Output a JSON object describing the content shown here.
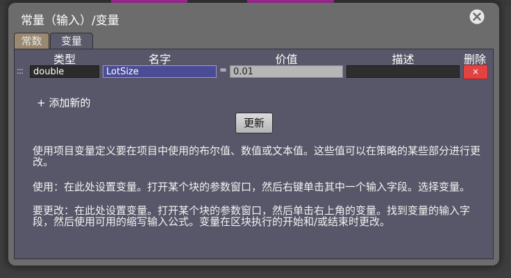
{
  "dialog": {
    "title": "常量（输入）/变量"
  },
  "tabs": [
    {
      "label": "常数"
    },
    {
      "label": "变量"
    }
  ],
  "table": {
    "headers": {
      "type": "类型",
      "name": "名字",
      "value": "价值",
      "description": "描述",
      "delete": "删除"
    },
    "rows": [
      {
        "type": "double",
        "name": "LotSize",
        "equals": "=",
        "value": "0.01",
        "description": "",
        "delete_label": "×"
      }
    ]
  },
  "actions": {
    "add_new": "+ 添加新的",
    "update": "更新"
  },
  "help": {
    "p1": "使用项目变量定义要在项目中使用的布尔值、数值或文本值。这些值可以在策略的某些部分进行更改。",
    "p2": "使用：在此处设置变量。打开某个块的参数窗口，然后右键单击其中一个输入字段。选择变量。",
    "p3": "要更改：在此处设置变量。打开某个块的参数窗口，然后单击右上角的变量。找到变量的输入字段，然后使用可用的缩写输入公式。变量在区块执行的开始和/或结束时更改。"
  },
  "colors": {
    "dialog_bg": "#6c6c6c",
    "panel_bg": "#575769",
    "name_field": "#4b4c96",
    "delete_button": "#e24242",
    "background_tag": "#c02fb5"
  }
}
